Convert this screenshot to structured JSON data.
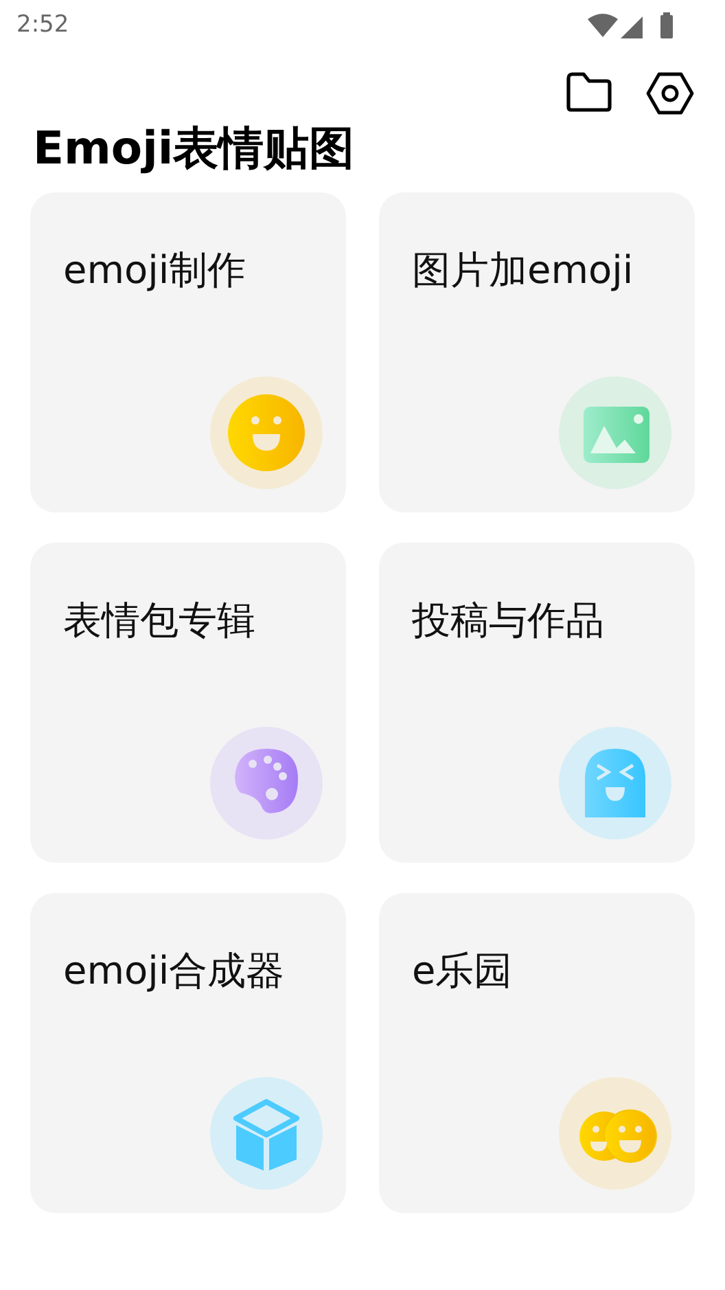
{
  "status_bar": {
    "time": "2:52"
  },
  "title": "Emoji表情贴图",
  "cards": [
    {
      "label": "emoji制作",
      "kind": "smiley"
    },
    {
      "label": "图片加emoji",
      "kind": "image"
    },
    {
      "label": "表情包专辑",
      "kind": "palette"
    },
    {
      "label": "投稿与作品",
      "kind": "ghost"
    },
    {
      "label": "emoji合成器",
      "kind": "cube"
    },
    {
      "label": "e乐园",
      "kind": "pair"
    }
  ]
}
